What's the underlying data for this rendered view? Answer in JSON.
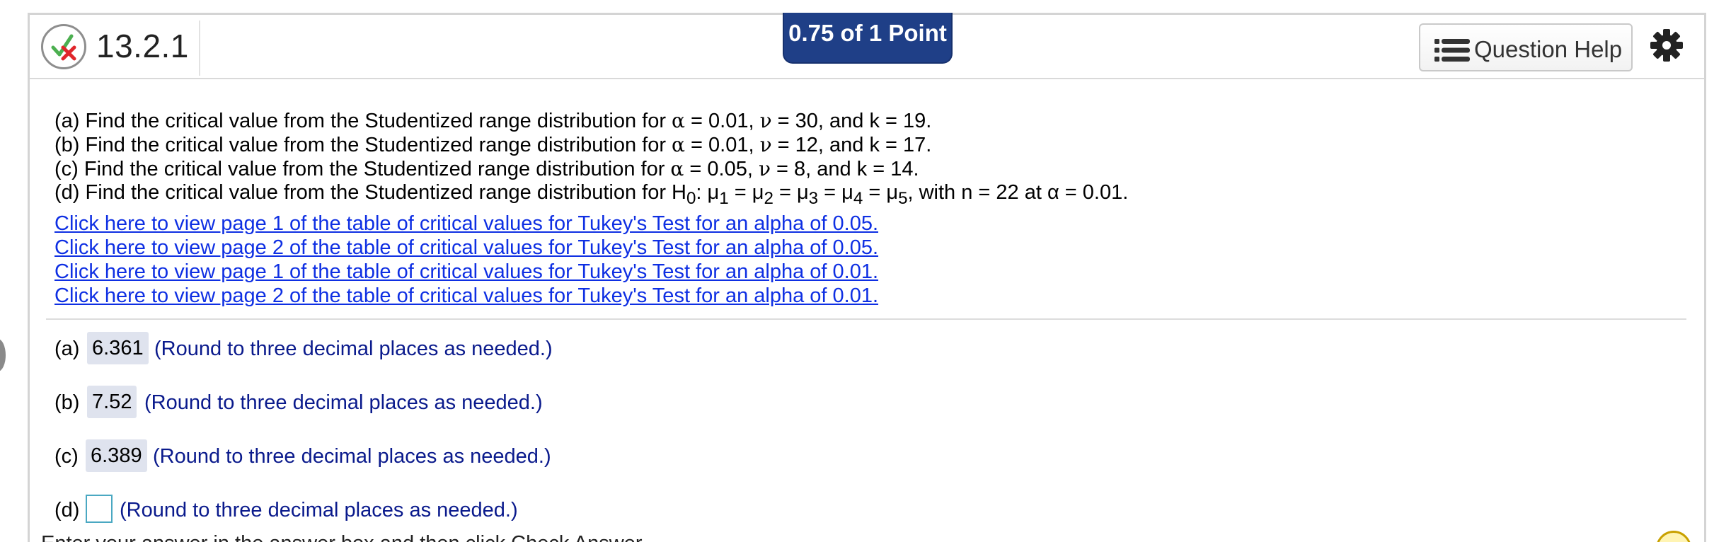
{
  "header": {
    "question_number": "13.2.1",
    "score": "0.75 of 1 Point",
    "help_label": "Question Help"
  },
  "questions": {
    "a": {
      "pre": "(a) Find the critical value from the Studentized range distribution for ",
      "alpha": "α",
      "post": " = 0.01, ",
      "nu": "ν",
      "rest": " = 30, and k = 19."
    },
    "b": {
      "pre": "(b) Find the critical value from the Studentized range distribution for ",
      "alpha": "α",
      "post": " = 0.01, ",
      "nu": "ν",
      "rest": " = 12, and k = 17."
    },
    "c": {
      "pre": "(c) Find the critical value from the Studentized range distribution for ",
      "alpha": "α",
      "post": " = 0.05, ",
      "nu": "ν",
      "rest": " = 8, and k = 14."
    },
    "d": {
      "pre": "(d) Find the critical value from the Studentized range distribution for H",
      "sub0": "0",
      "mid": ": μ",
      "s1": "1",
      "e1": " = μ",
      "s2": "2",
      "e2": " = μ",
      "s3": "3",
      "e3": " = μ",
      "s4": "4",
      "e4": " = μ",
      "s5": "5",
      "end": ", with n = 22 at α = 0.01."
    }
  },
  "links": [
    "Click here to view page 1 of the table of critical values for Tukey's Test for an alpha of 0.05.",
    "Click here to view page 2 of the table of critical values for Tukey's Test for an alpha of 0.05.",
    "Click here to view page 1 of the table of critical values for Tukey's Test for an alpha of 0.01.",
    "Click here to view page 2 of the table of critical values for Tukey's Test for an alpha of 0.01."
  ],
  "answers": {
    "a": {
      "prefix": "(a)",
      "value": "6.361",
      "hint": "(Round to three decimal places as needed.)"
    },
    "b": {
      "prefix": "(b)",
      "value": "7.52",
      "hint": "(Round to three decimal places as needed.)"
    },
    "c": {
      "prefix": "(c)",
      "value": "6.389",
      "hint": "(Round to three decimal places as needed.)"
    },
    "d": {
      "prefix": "(d)",
      "value": "",
      "hint": "(Round to three decimal places as needed.)"
    }
  },
  "footer_text": "Enter your answer in the answer box and then click Check Answer.",
  "colors": {
    "score_badge": "#1f3f87",
    "link": "#0e2fe3",
    "hint": "#0a1a8c",
    "answer_fill": "#dfe3ee",
    "input_border": "#4aa8c2"
  },
  "icons": [
    "partially-correct-icon",
    "list-icon",
    "gear-icon"
  ]
}
